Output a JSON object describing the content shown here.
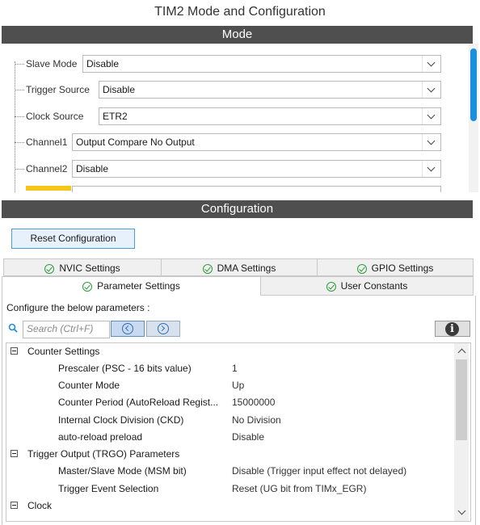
{
  "window_title": "TIM2 Mode and Configuration",
  "mode_header": "Mode",
  "mode_fields": [
    {
      "label": "Slave Mode",
      "value": "Disable"
    },
    {
      "label": "Trigger Source",
      "value": "Disable"
    },
    {
      "label": "Clock Source",
      "value": "ETR2"
    },
    {
      "label": "Channel1",
      "value": "Output Compare No Output"
    },
    {
      "label": "Channel2",
      "value": "Disable"
    }
  ],
  "config_header": "Configuration",
  "reset_button": "Reset Configuration",
  "tabs_top": [
    {
      "label": "NVIC Settings"
    },
    {
      "label": "DMA Settings"
    },
    {
      "label": "GPIO Settings"
    }
  ],
  "tabs_bottom": [
    {
      "label": "Parameter Settings",
      "active": true
    },
    {
      "label": "User Constants",
      "active": false
    }
  ],
  "hint_text": "Configure the below parameters :",
  "search": {
    "placeholder": "Search (Ctrl+F)"
  },
  "info_glyph": "i",
  "param_groups": [
    {
      "name": "Counter Settings",
      "params": [
        {
          "name": "Prescaler (PSC - 16 bits value)",
          "value": "1"
        },
        {
          "name": "Counter Mode",
          "value": "Up"
        },
        {
          "name": "Counter Period (AutoReload Regist...",
          "value": "15000000"
        },
        {
          "name": "Internal Clock Division (CKD)",
          "value": "No Division"
        },
        {
          "name": "auto-reload preload",
          "value": "Disable"
        }
      ]
    },
    {
      "name": "Trigger Output (TRGO) Parameters",
      "params": [
        {
          "name": "Master/Slave Mode (MSM bit)",
          "value": "Disable (Trigger input effect not delayed)"
        },
        {
          "name": "Trigger Event Selection",
          "value": "Reset (UG bit from TIMx_EGR)"
        }
      ]
    },
    {
      "name": "Clock",
      "params": []
    }
  ],
  "colors": {
    "header_bar": "#4f4f4f",
    "accent": "#1c8ede",
    "check": "#2a9d3a"
  }
}
